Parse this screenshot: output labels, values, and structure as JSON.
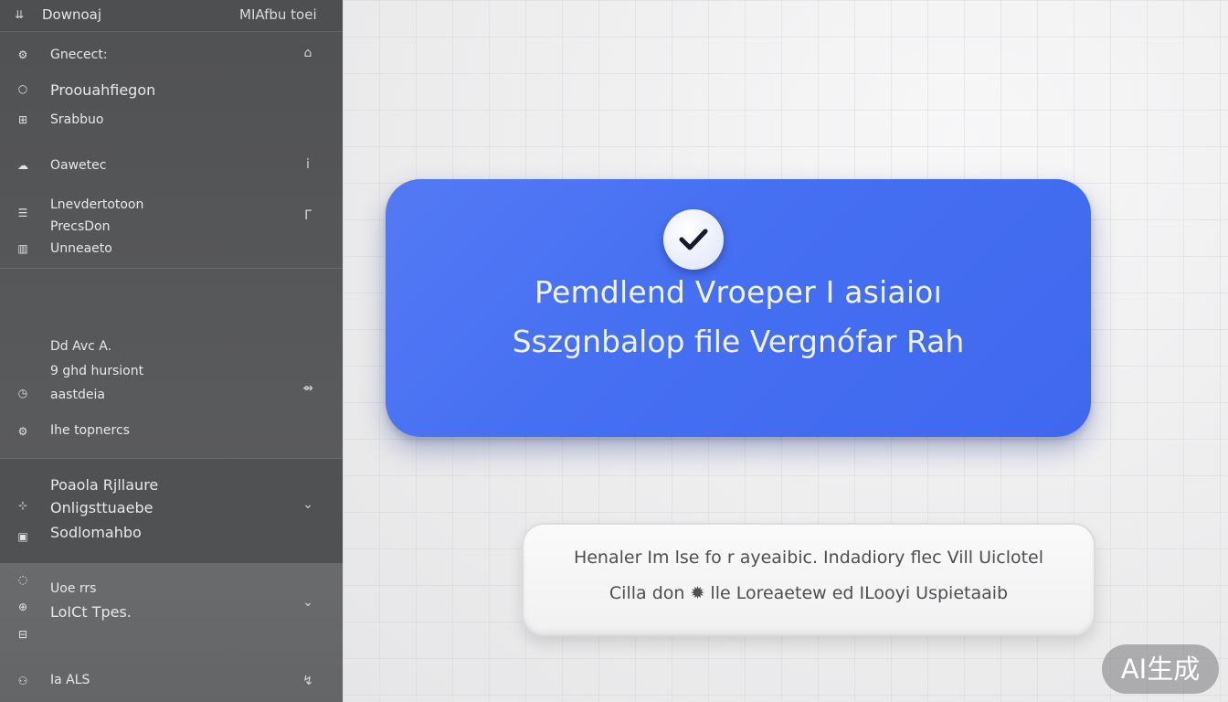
{
  "header": {
    "icon": "download-icon",
    "title": "Downoaj",
    "right": "MIAfbu toei"
  },
  "sidebar": {
    "section1": [
      {
        "icon": "gear-icon",
        "label": "Gnecect:",
        "action": "bell-icon",
        "action_glyph": "⌂"
      },
      {
        "icon": "circle-icon",
        "label": "Proouahfiegon"
      },
      {
        "icon": "grid-icon",
        "label": "Srabbuo"
      },
      {
        "icon": "cloud-icon",
        "label": "Oawetec",
        "action": "info-icon",
        "action_glyph": "ⅰ"
      },
      {
        "icon": "list-icon",
        "label": "Lnevdertotoon",
        "action": "phone-icon",
        "action_glyph": "ᒥ"
      },
      {
        "label": "PrecsDon"
      },
      {
        "icon": "columns-icon",
        "label": "Unneaeto"
      }
    ],
    "section2": [
      {
        "label": "Dd Avc A."
      },
      {
        "label": "9 ghd hursiont"
      },
      {
        "icon": "clock-icon",
        "label": "aastdeia",
        "action": "arrow-icon",
        "action_glyph": "⇴"
      },
      {
        "icon": "sliders-icon",
        "label": "Ihe topnercs"
      }
    ],
    "section3": [
      {
        "label": "Poaola Rjllaure"
      },
      {
        "icon": "plus-icon",
        "label": "Onligsttuaebe",
        "action": "chevron-down-icon",
        "action_glyph": "⌄"
      },
      {
        "icon": "box-icon",
        "label": "Sodlomahbo"
      }
    ],
    "section4": [
      {
        "icon": "circle-icon",
        "label": "Uoe rrs"
      },
      {
        "icon": "pin-icon",
        "label": "LoICt Tpes.",
        "action": "chevron-down-icon",
        "action_glyph": "⌄"
      },
      {
        "icon": "calendar-icon",
        "label": ""
      },
      {
        "icon": "user-icon",
        "label": "Ia ALS",
        "action": "refresh-icon",
        "action_glyph": "↯"
      }
    ]
  },
  "card": {
    "line1": "Pemdlend Vroeper I asiaioı",
    "line2": "Sszgnbalop file Vergnófar Rah"
  },
  "info": {
    "line1": "Henaler   Im lse fo r ayeaibic. Indadiory flec Vill Uiclotel",
    "line2": "Cilla don  ✹ lle Loreaetew ed ILooyi Uspietaaib"
  },
  "badge": "AI生成",
  "colors": {
    "accent": "#4670f2",
    "sidebar": "#545557"
  }
}
